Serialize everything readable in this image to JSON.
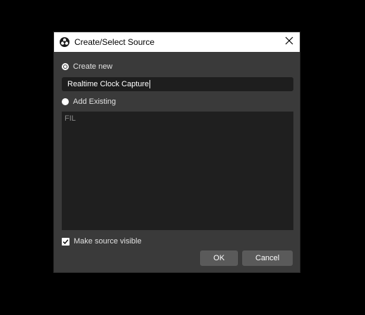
{
  "dialog": {
    "title": "Create/Select Source",
    "app_icon": "obs-icon",
    "close_icon": "close-icon"
  },
  "options": {
    "create_new_label": "Create new",
    "create_new_selected": true,
    "add_existing_label": "Add Existing",
    "add_existing_selected": false
  },
  "name_input": {
    "value": "Realtime Clock Capture"
  },
  "existing_list": {
    "items": [
      "FIL"
    ]
  },
  "visibility": {
    "label": "Make source visible",
    "checked": true
  },
  "buttons": {
    "ok_label": "OK",
    "cancel_label": "Cancel"
  },
  "colors": {
    "dialog_bg": "#3a3a3a",
    "input_bg": "#1e1e1e",
    "button_bg": "#5a5a5a",
    "titlebar_bg": "#ffffff"
  }
}
